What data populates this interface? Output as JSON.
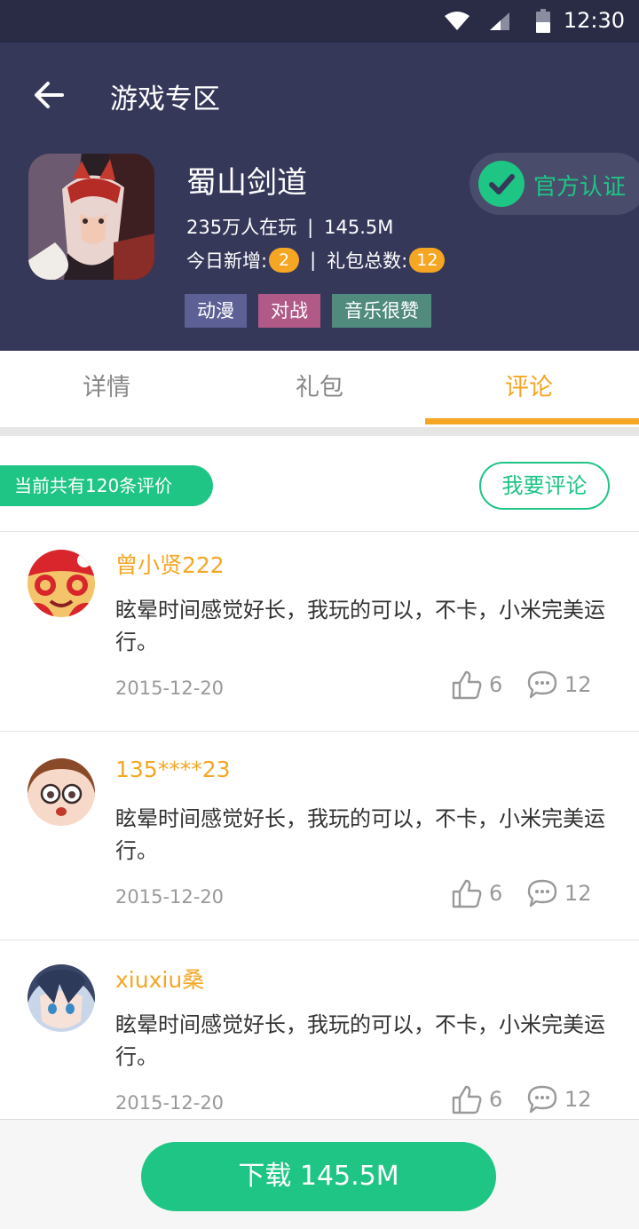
{
  "status_bar": {
    "time": "12:30"
  },
  "header": {
    "title": "游戏专区",
    "game": {
      "name": "蜀山剑道",
      "players": "235万人在玩",
      "size": "145.5M",
      "today_new_label": "今日新增:",
      "today_new_count": "2",
      "gift_total_label": "礼包总数:",
      "gift_total_count": "12",
      "separator": "|",
      "tags": [
        "动漫",
        "对战",
        "音乐很赞"
      ],
      "verified_label": "官方认证"
    }
  },
  "tabs": [
    {
      "label": "详情",
      "active": false
    },
    {
      "label": "礼包",
      "active": false
    },
    {
      "label": "评论",
      "active": true
    }
  ],
  "comments_section": {
    "count_text": "当前共有120条评价",
    "write_comment_label": "我要评论",
    "items": [
      {
        "username": "曾小贤222",
        "text": "眩晕时间感觉好长，我玩的可以，不卡，小米完美运行。",
        "date": "2015-12-20",
        "likes": "6",
        "replies": "12"
      },
      {
        "username": "135****23",
        "text": "眩晕时间感觉好长，我玩的可以，不卡，小米完美运行。",
        "date": "2015-12-20",
        "likes": "6",
        "replies": "12"
      },
      {
        "username": "xiuxiu桑",
        "text": "眩晕时间感觉好长，我玩的可以，不卡，小米完美运行。",
        "date": "2015-12-20",
        "likes": "6",
        "replies": "12"
      }
    ]
  },
  "download": {
    "label": "下载 145.5M"
  },
  "colors": {
    "header_bg": "#36385a",
    "accent_green": "#1fc585",
    "accent_orange": "#f5a623"
  }
}
